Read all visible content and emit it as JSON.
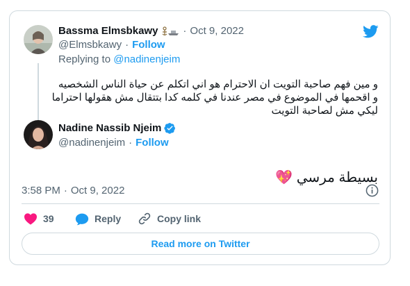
{
  "quoted": {
    "author_name": "Bassma Elmsbkawy",
    "separator": "·",
    "date": "Oct 9, 2022",
    "handle": "@Elmsbkawy",
    "follow_label": "Follow",
    "replying_prefix": "Replying to ",
    "replying_handle": "@nadinenjeim",
    "text": "و مين فهم صاحبة التويت ان الاحترام هو اني اتكلم عن حياة الناس الشخصيه و اقحمها في الموضوع في مصر عندنا في كلمه كدا بتتقال مش هقولها احتراما ليكي مش لصاحبة التويت"
  },
  "main": {
    "author_name": "Nadine Nassib Njeim",
    "handle": "@nadinenjeim",
    "separator": "·",
    "follow_label": "Follow",
    "text": "بسيطة مرسي 💖",
    "time": "3:58 PM",
    "date": "Oct 9, 2022"
  },
  "actions": {
    "like_count": "39",
    "reply_label": "Reply",
    "copy_link_label": "Copy link"
  },
  "read_more_label": "Read more on Twitter",
  "colors": {
    "accent": "#1d9bf0",
    "like": "#f91880",
    "text": "#0f1419",
    "muted": "#536471",
    "border": "#cfd9de"
  },
  "icons": [
    "twitter-bird-icon",
    "verified-badge-icon",
    "info-icon",
    "heart-icon",
    "reply-bubble-icon",
    "link-icon",
    "sparkling-heart-emoji"
  ]
}
